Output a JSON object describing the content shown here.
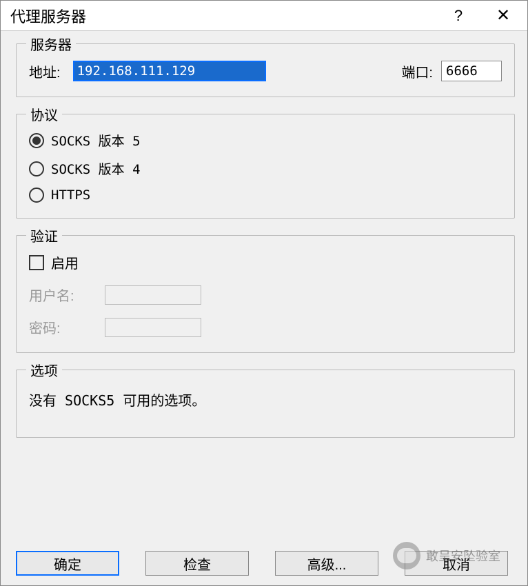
{
  "titlebar": {
    "title": "代理服务器",
    "help": "?",
    "close": "✕"
  },
  "server": {
    "legend": "服务器",
    "address_label": "地址:",
    "address_value": "192.168.111.129",
    "port_label": "端口:",
    "port_value": "6666"
  },
  "protocol": {
    "legend": "协议",
    "options": [
      {
        "label": "SOCKS 版本 5",
        "selected": true
      },
      {
        "label": "SOCKS 版本 4",
        "selected": false
      },
      {
        "label": "HTTPS",
        "selected": false
      }
    ]
  },
  "auth": {
    "legend": "验证",
    "enable_label": "启用",
    "enable_checked": false,
    "username_label": "用户名:",
    "password_label": "密码:"
  },
  "options": {
    "legend": "选项",
    "text": "没有 SOCKS5 可用的选项。"
  },
  "buttons": {
    "ok": "确定",
    "check": "检查",
    "advanced": "高级...",
    "cancel": "取消"
  },
  "watermark": {
    "text": "敢呈安坠验室"
  }
}
